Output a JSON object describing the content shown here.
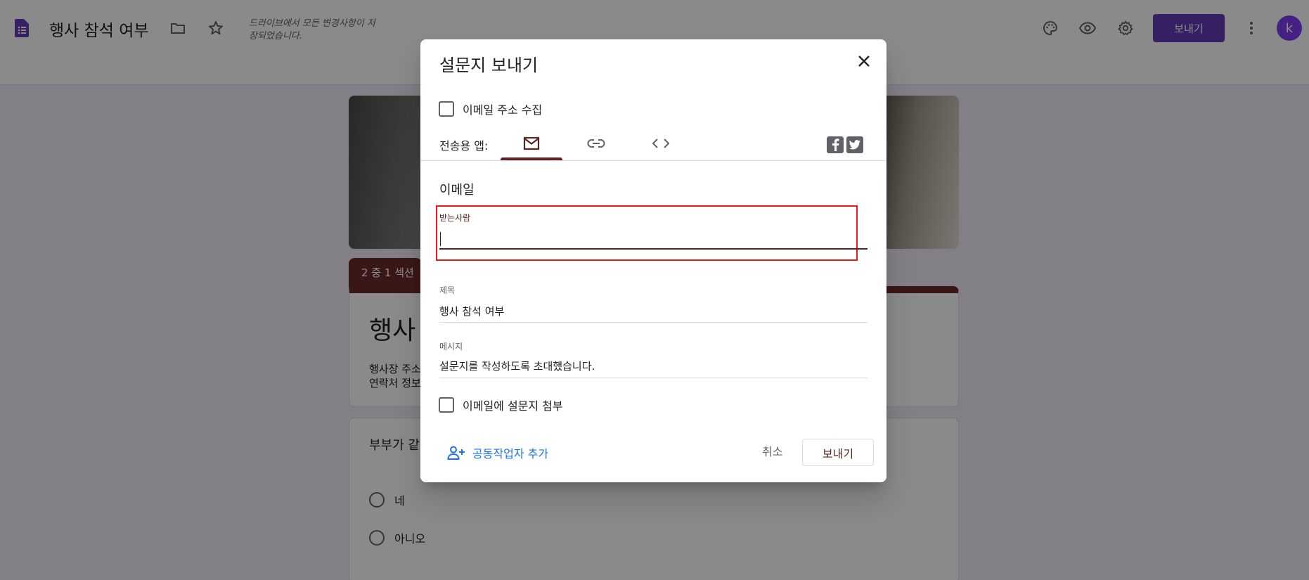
{
  "appbar": {
    "doc_title": "행사 참석 여부",
    "save_status": "드라이브에서 모든 변경사항이 저장되었습니다.",
    "send_label": "보내기",
    "avatar_letter": "k",
    "icons": [
      "forms-doc-icon",
      "folder-icon",
      "star-icon",
      "palette-icon",
      "preview-eye-icon",
      "settings-gear-icon",
      "more-vert-icon"
    ]
  },
  "form": {
    "section_tab": "2 중 1 섹션",
    "title": "행사 참석 여부",
    "description_line1": "행사장 주소: ",
    "description_line2": "연락처 정보: ",
    "question": {
      "title": "부부가 같이 ",
      "options": [
        "네",
        "아니오"
      ]
    }
  },
  "dialog": {
    "title": "설문지 보내기",
    "collect_email_label": "이메일 주소 수집",
    "send_via_label": "전송용 앱:",
    "tabs": [
      {
        "name": "email",
        "icon": "mail-icon",
        "active": true
      },
      {
        "name": "link",
        "icon": "link-icon",
        "active": false
      },
      {
        "name": "embed",
        "icon": "code-icon",
        "active": false
      }
    ],
    "social": [
      "facebook-icon",
      "twitter-icon"
    ],
    "section_label": "이메일",
    "to": {
      "label": "받는사람",
      "value": ""
    },
    "subject": {
      "label": "제목",
      "value": "행사 참석 여부"
    },
    "message": {
      "label": "메시지",
      "value": "설문지를 작성하도록 초대했습니다."
    },
    "attach_label": "이메일에 설문지 첨부",
    "add_collaborators": "공동작업자 추가",
    "cancel": "취소",
    "send": "보내기"
  },
  "colors": {
    "accent": "#5b2323",
    "header_purple": "#673ab7",
    "link_blue": "#1a73e8",
    "highlight_red": "#e01e1e"
  }
}
